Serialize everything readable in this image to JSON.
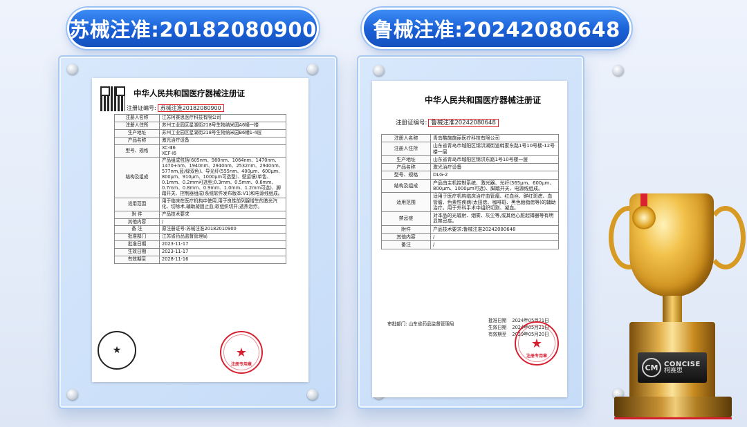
{
  "badges": {
    "left": "苏械注准:20182080900",
    "right": "鲁械注准:20242080648"
  },
  "cert_left": {
    "title": "中华人民共和国医疗器械注册证",
    "reg_label": "注册证编号:",
    "reg_value": "苏械注准20182080900",
    "rows": [
      {
        "k": "注册人名称",
        "v": "江苏柯赛思医疗科技有限公司"
      },
      {
        "k": "注册人住所",
        "v": "苏州工业园区星湖街218号生物纳米园A6幢一楼"
      },
      {
        "k": "生产地址",
        "v": "苏州工业园区星湖街218号生物纳米园B6幢1-4层"
      },
      {
        "k": "产品名称",
        "v": "激光治疗设备"
      },
      {
        "k": "型号、规格",
        "v": "XC-Ⅲ6\nXCF-Ⅰ6"
      },
      {
        "k": "结构及组成",
        "v": "产品组成包括(605nm、980nm、1064nm、1470nm、1470+nm、1940nm、2940nm、2532nm、2940nm、577nm,蓝/绿双色)、导光纤(555nm、400μm、600μm、800μm、910μm、1000μm可选型)、壁运镜(单色、0.1mm、0.2mm可选型;0.3mm、0.5mm、0.6mm、0.7mm、0.8mm、0.9mm、1.0mm、1.2mm可选)、脚踏开关、控制器组成(系统软件发布版本:V1)和电源线组成。"
      },
      {
        "k": "适用范围",
        "v": "用于临床在医疗机构中使用,用于良性前列腺增生的激光汽化、切除术,辅助凝固止血;软组织切开;透热治疗。"
      },
      {
        "k": "附 件",
        "v": "产品技术要求"
      },
      {
        "k": "其他内容",
        "v": "/"
      },
      {
        "k": "备 注",
        "v": "原注册证号:苏械注准20182010900"
      },
      {
        "k": "批准部门",
        "v": "江苏省药品监督管理局"
      },
      {
        "k": "批准日期",
        "v": "2023-11-17"
      },
      {
        "k": "生效日期",
        "v": "2023-11-17"
      },
      {
        "k": "有效期至",
        "v": "2028-11-16"
      }
    ],
    "stamp_caption": "注册专用章"
  },
  "cert_right": {
    "title": "中华人民共和国医疗器械注册证",
    "reg_label": "注册证编号:",
    "reg_value": "鲁械注准20242080648",
    "rows": [
      {
        "k": "注册人名称",
        "v": "青岛酷施施丽医疗科技有限公司"
      },
      {
        "k": "注册人住所",
        "v": "山东省青岛市城阳区锦洪湖街道韩家东路1号10号楼-12号楼一层"
      },
      {
        "k": "生产地址",
        "v": "山东省青岛市城阳区锦洪东路1号10号楼一层"
      },
      {
        "k": "产品名称",
        "v": "激光治疗设备"
      },
      {
        "k": "型号、规格",
        "v": "DLG-2"
      },
      {
        "k": "结构及组成",
        "v": "产品由主机控制系统、激光器、光纤(365μm、600μm、800μm、1000μm可选)、脚踏开关、电源线组成。"
      },
      {
        "k": "适用范围",
        "v": "适用于医疗机构临床治疗血管瘤、红血丝、鲜红斑痣、血管瘤、色素性疾病(太田痣、咖啡斑、黑色胎脂痣等)的辅助治疗。用于外科手术中组织切割、凝血。"
      },
      {
        "k": "禁忌症",
        "v": "对本品的光辐射、烟雾、灰尘等,或其他心脏起搏器等有明显禁忌症。"
      },
      {
        "k": "附件",
        "v": "产品技术要求:鲁械注准20242080648"
      },
      {
        "k": "其他内容",
        "v": "/"
      },
      {
        "k": "备注",
        "v": "/"
      }
    ],
    "approval_dept": "审批部门:  山东省药品监督管理局",
    "dates": [
      {
        "k": "批准日期",
        "v": "2024年05月21日"
      },
      {
        "k": "生效日期",
        "v": "2024年05月21日"
      },
      {
        "k": "有效期至",
        "v": "2029年05月20日"
      }
    ],
    "stamp_caption": "注册专用章"
  },
  "brand": {
    "en": "CONCISE",
    "cn": "柯赛思",
    "mark": "CM"
  },
  "colors": {
    "accent": "#1a5fd6",
    "stamp": "#d62030",
    "gold": "#d79a22"
  }
}
